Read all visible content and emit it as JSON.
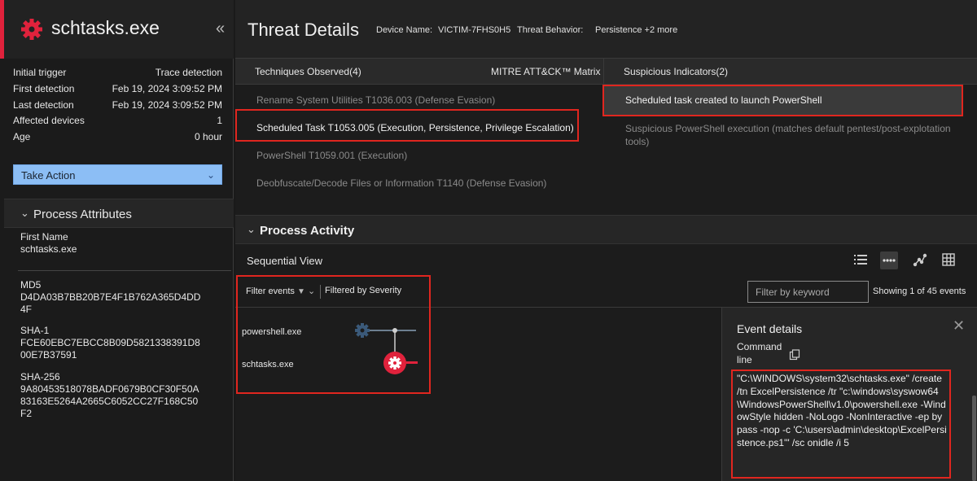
{
  "left": {
    "title": "schtasks.exe",
    "collapse": "«",
    "facts": [
      {
        "label": "Initial trigger",
        "value": "Trace detection"
      },
      {
        "label": "First detection",
        "value": "Feb 19, 2024 3:09:52 PM"
      },
      {
        "label": "Last detection",
        "value": "Feb 19, 2024 3:09:52 PM"
      },
      {
        "label": "Affected devices",
        "value": "1"
      },
      {
        "label": "Age",
        "value": "0 hour"
      }
    ],
    "take_action": "Take Action",
    "process_attributes_label": "Process Attributes",
    "attributes": [
      {
        "label": "First Name",
        "value": "schtasks.exe"
      },
      {
        "label": "MD5",
        "value": "D4DA03B7BB20B7E4F1B762A365D4DD4F"
      },
      {
        "label": "SHA-1",
        "value": "FCE60EBC7EBCC8B09D5821338391D800E7B37591"
      },
      {
        "label": "SHA-256",
        "value": "9A80453518078BADF0679B0CF30F50A83163E5264A2665C6052CC27F168C50F2"
      }
    ]
  },
  "header": {
    "title": "Threat Details",
    "device_label": "Device Name:",
    "device_value": "VICTIM-7FHS0H5",
    "behavior_label": "Threat Behavior:",
    "behavior_value": "Persistence +2 more"
  },
  "tabs": {
    "techniques": "Techniques Observed(4)",
    "mitre": "MITRE ATT&CK™ Matrix",
    "indicators": "Suspicious Indicators(2)"
  },
  "techniques": [
    "Rename System Utilities T1036.003 (Defense Evasion)",
    "Scheduled Task T1053.005 (Execution, Persistence, Privilege Escalation)",
    "PowerShell T1059.001 (Execution)",
    "Deobfuscate/Decode Files or Information T1140 (Defense Evasion)"
  ],
  "indicators": [
    "Scheduled task created to launch PowerShell",
    "Suspicious PowerShell execution (matches default pentest/post-explotation tools)"
  ],
  "process_activity": {
    "label": "Process Activity",
    "view": "Sequential View",
    "filter_events": "Filter events",
    "filtered_by": "Filtered by Severity",
    "keyword_placeholder": "Filter by keyword",
    "showing": "Showing 1 of 45 events",
    "processes": [
      "powershell.exe",
      "schtasks.exe"
    ]
  },
  "event_details": {
    "title": "Event details",
    "command_label": "Command line",
    "command": "\"C:\\WINDOWS\\system32\\schtasks.exe\" /create /tn ExcelPersistence /tr \"c:\\windows\\syswow64\\WindowsPowerShell\\v1.0\\powershell.exe -WindowStyle hidden -NoLogo -NonInteractive -ep bypass -nop -c 'C:\\users\\admin\\desktop\\ExcelPersistence.ps1'\" /sc onidle /i 5"
  },
  "colors": {
    "accent_red": "#e0223c",
    "highlight_box": "#e0261f",
    "take_action_bg": "#8cbef5"
  }
}
